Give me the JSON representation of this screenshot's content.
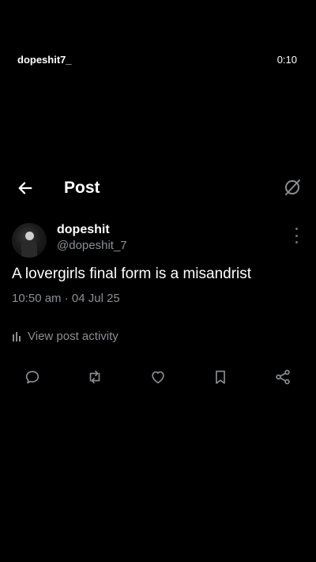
{
  "overlay": {
    "username": "dopeshit7_",
    "time": "0:10"
  },
  "header": {
    "title": "Post"
  },
  "post": {
    "display_name": "dopeshit",
    "handle": "@dopeshit_7",
    "text": "A lovergirls final form is a misandrist",
    "timestamp": "10:50 am · 04 Jul 25"
  },
  "activity": {
    "label": "View post activity"
  },
  "actions": {
    "icons": [
      "reply-icon",
      "repost-icon",
      "like-icon",
      "bookmark-icon",
      "share-icon"
    ]
  },
  "colors": {
    "background": "#000000",
    "text": "#ffffff",
    "secondary_text": "#8b8f94",
    "icon": "#8b8f94"
  }
}
